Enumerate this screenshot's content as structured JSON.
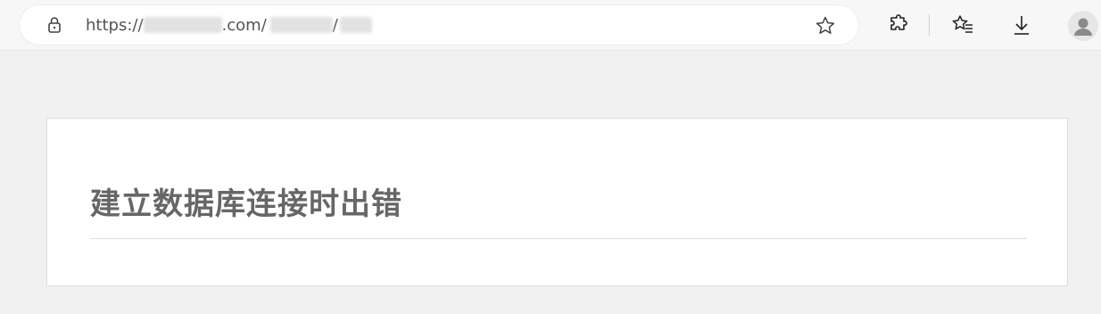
{
  "browser": {
    "url_prefix": "https://",
    "url_domain_suffix": ".com/",
    "url_separator": "/",
    "icons": {
      "lock": "lock-icon",
      "favorite": "star-icon",
      "extensions": "puzzle-icon",
      "favorites_list": "favorites-icon",
      "downloads": "download-icon",
      "profile": "avatar"
    }
  },
  "page": {
    "error_title": "建立数据库连接时出错"
  },
  "colors": {
    "page_background": "#f1f1f1",
    "card_background": "#ffffff",
    "title_text": "#666666"
  }
}
